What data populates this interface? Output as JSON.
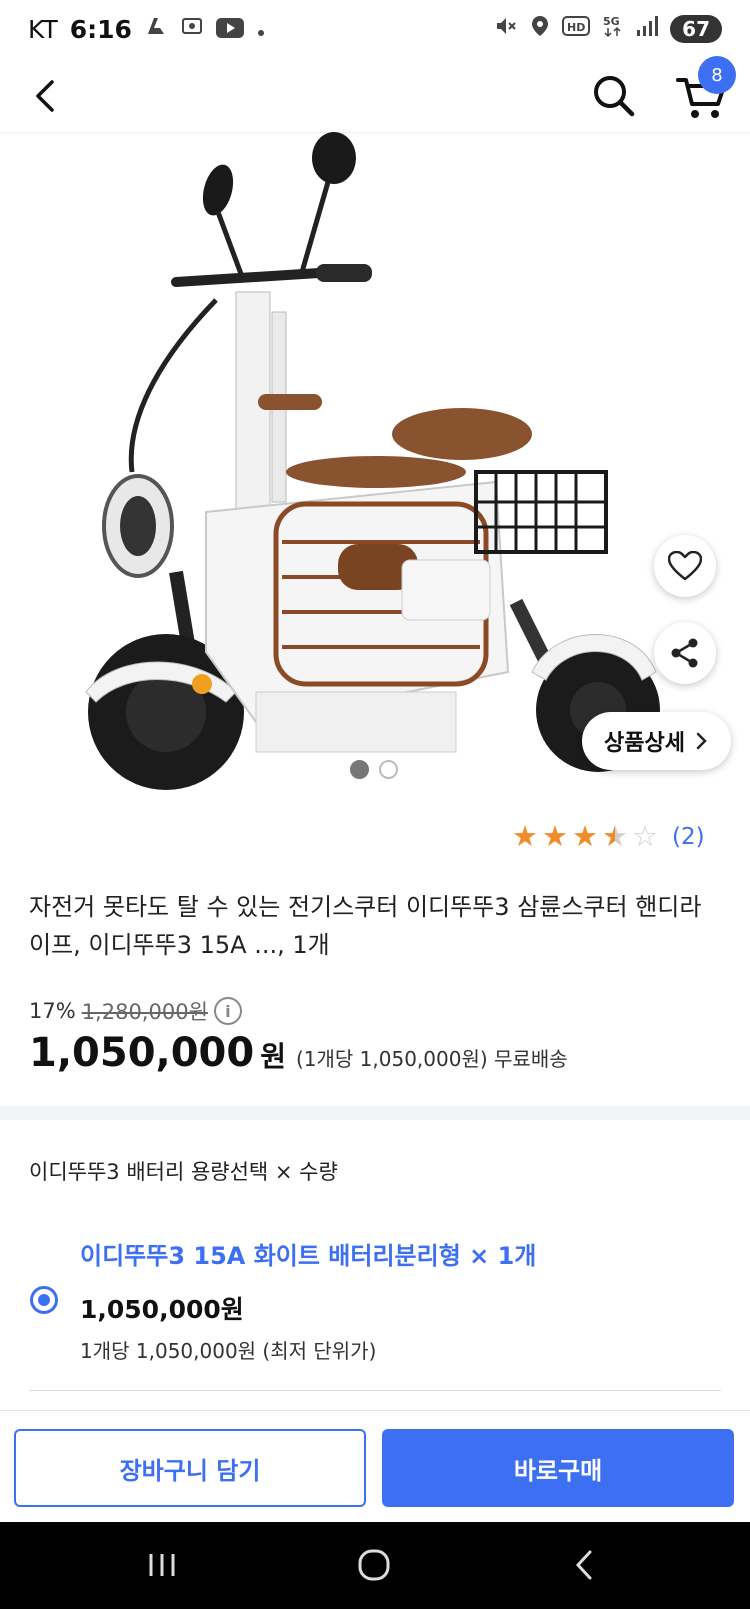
{
  "status_bar": {
    "carrier": "KT",
    "time": "6:16",
    "battery": "67",
    "icons": [
      "data-saver-icon",
      "screenshot-icon",
      "youtube-icon",
      "dot-icon",
      "mute-icon",
      "location-icon",
      "hd-icon",
      "5g-icon",
      "signal-icon"
    ]
  },
  "nav": {
    "cart_count": "8"
  },
  "gallery": {
    "image_alt": "electric tricycle scooter product photo",
    "image_count": 2,
    "active_index": 0,
    "detail_button_label": "상품상세"
  },
  "rating": {
    "stars": 3.5,
    "count_label": "(2)"
  },
  "product": {
    "title": "자전거 못타도 탈 수 있는 전기스쿠터 이디뚜뚜3 삼륜스쿠터 핸디라이프, 이디뚜뚜3 15A ..., 1개",
    "discount": "17%",
    "original_price": "1,280,000원",
    "final_price": "1,050,000",
    "won": "원",
    "unit_info": "(1개당 1,050,000원) 무료배송"
  },
  "option": {
    "label": "이디뚜뚜3 배터리 용량선택 × 수량",
    "name": "이디뚜뚜3 15A 화이트 배터리분리형 × 1개",
    "price": "1,050,000원",
    "unit": "1개당 1,050,000원 (최저 단위가)"
  },
  "actions": {
    "add_to_cart": "장바구니 담기",
    "buy_now": "바로구매"
  },
  "colors": {
    "accent": "#3d6ff2",
    "star": "#f08c2a"
  }
}
